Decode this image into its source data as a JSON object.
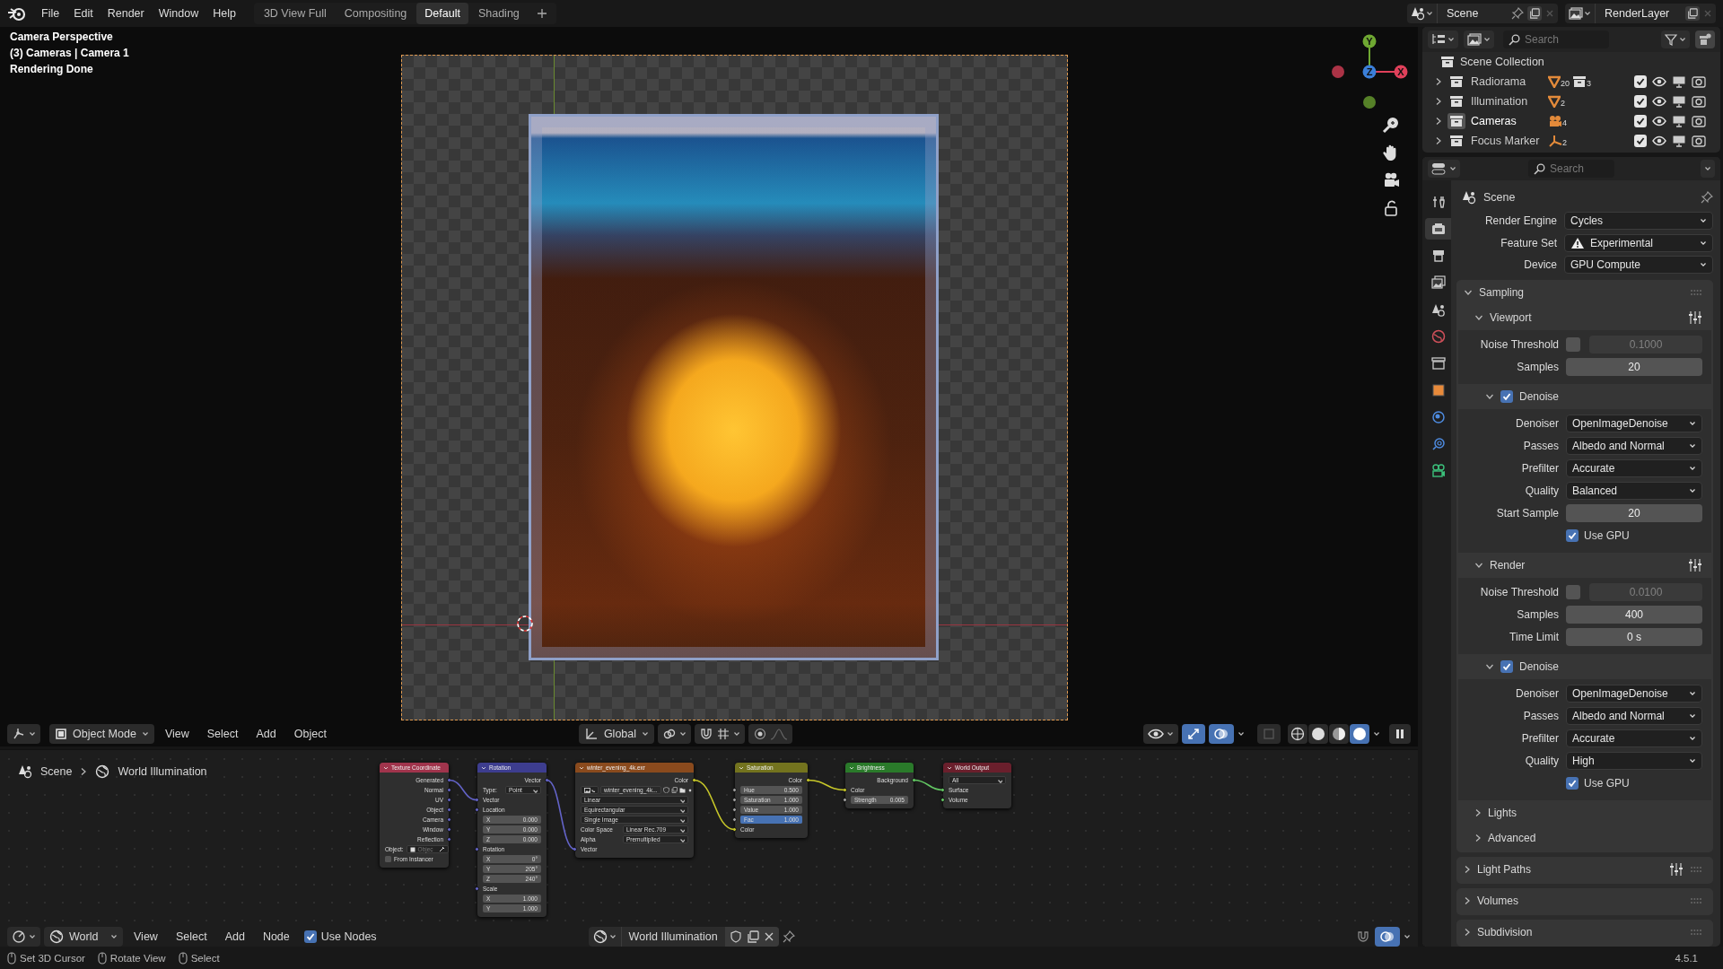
{
  "top_bar": {
    "menu": [
      "File",
      "Edit",
      "Render",
      "Window",
      "Help"
    ],
    "workspaces": [
      {
        "label": "3D View Full",
        "selected": false
      },
      {
        "label": "Compositing",
        "selected": false
      },
      {
        "label": "Default",
        "selected": true
      },
      {
        "label": "Shading",
        "selected": false
      }
    ],
    "scene": "Scene",
    "view_layer": "RenderLayer"
  },
  "viewport": {
    "info": [
      "Camera Perspective",
      "(3) Cameras | Camera 1",
      "Rendering Done"
    ],
    "gizmo": [
      {
        "axis": "Y",
        "color": "#6fa832"
      },
      {
        "axis": "Z",
        "color": "#3b7fd9"
      },
      {
        "axis": "X",
        "color": "#e0405a"
      }
    ],
    "header": {
      "mode": "Object Mode",
      "menus": [
        "View",
        "Select",
        "Add",
        "Object"
      ],
      "orientation": "Global",
      "shading": [
        {
          "kind": "wireframe",
          "selected": false
        },
        {
          "kind": "solid",
          "selected": false
        },
        {
          "kind": "material",
          "selected": false
        },
        {
          "kind": "rendered",
          "selected": true
        }
      ]
    }
  },
  "node_editor": {
    "breadcrumbs": [
      "Scene",
      "World Illumination"
    ],
    "nodes": [
      {
        "title": "Texture Coordinate",
        "color": "#a0344c",
        "rows": [
          {
            "kind": "output",
            "label": "Generated",
            "color": "#6363c7"
          },
          {
            "kind": "output",
            "label": "Normal",
            "color": "#6363c7"
          },
          {
            "kind": "output",
            "label": "UV",
            "color": "#6363c7"
          },
          {
            "kind": "output",
            "label": "Object",
            "color": "#6363c7"
          },
          {
            "kind": "output",
            "label": "Camera",
            "color": "#6363c7"
          },
          {
            "kind": "output",
            "label": "Window",
            "color": "#6363c7"
          },
          {
            "kind": "output",
            "label": "Reflection",
            "color": "#6363c7"
          },
          {
            "kind": "object_field",
            "label": "Object:",
            "placeholder": "Objec"
          },
          {
            "kind": "checkbox",
            "label": "From Instancer",
            "checked": false
          }
        ]
      },
      {
        "title": "Rotation",
        "color": "#3d3d8f",
        "rows": [
          {
            "kind": "output",
            "label": "Vector",
            "color": "#6363c7"
          },
          {
            "kind": "labeled_dropdown",
            "label": "Type:",
            "value": "Point"
          },
          {
            "kind": "input",
            "label": "Vector",
            "color": "#6363c7"
          },
          {
            "kind": "input",
            "label": "Location",
            "color": "#6363c7"
          },
          {
            "kind": "field",
            "label": "X",
            "value": "0.000"
          },
          {
            "kind": "field",
            "label": "Y",
            "value": "0.000"
          },
          {
            "kind": "field",
            "label": "Z",
            "value": "0.000"
          },
          {
            "kind": "input",
            "label": "Rotation",
            "color": "#6363c7"
          },
          {
            "kind": "field",
            "label": "X",
            "value": "0°"
          },
          {
            "kind": "field",
            "label": "Y",
            "value": "205°"
          },
          {
            "kind": "field",
            "label": "Z",
            "value": "240°"
          },
          {
            "kind": "input",
            "label": "Scale",
            "color": "#6363c7"
          },
          {
            "kind": "field",
            "label": "X",
            "value": "1.000"
          },
          {
            "kind": "field",
            "label": "Y",
            "value": "1.000"
          }
        ]
      },
      {
        "title": "winter_evening_4k.exr",
        "color": "#8a4a1d",
        "rows": [
          {
            "kind": "output",
            "label": "Color",
            "color": "#c7c729"
          },
          {
            "kind": "image_field",
            "value": "winter_evening_4k..."
          },
          {
            "kind": "dropdown",
            "value": "Linear"
          },
          {
            "kind": "dropdown",
            "value": "Equirectangular"
          },
          {
            "kind": "dropdown",
            "value": "Single Image"
          },
          {
            "kind": "labeled_dropdown",
            "label": "Color Space",
            "value": "Linear Rec.709"
          },
          {
            "kind": "labeled_dropdown",
            "label": "Alpha",
            "value": "Premultiplied"
          },
          {
            "kind": "input",
            "label": "Vector",
            "color": "#6363c7"
          }
        ]
      },
      {
        "title": "Saturation",
        "color": "#73731e",
        "rows": [
          {
            "kind": "output",
            "label": "Color",
            "color": "#c7c729"
          },
          {
            "kind": "input_field",
            "label": "Hue",
            "value": "0.500",
            "color": "#a1a1a1"
          },
          {
            "kind": "input_field",
            "label": "Saturation",
            "value": "1.000",
            "color": "#a1a1a1"
          },
          {
            "kind": "input_field",
            "label": "Value",
            "value": "1.000",
            "color": "#a1a1a1"
          },
          {
            "kind": "slider",
            "label": "Fac",
            "value": "1.000",
            "level": 1,
            "color": "#a1a1a1"
          },
          {
            "kind": "input",
            "label": "Color",
            "color": "#c7c729"
          }
        ]
      },
      {
        "title": "Brightness",
        "color": "#2a7a2a",
        "rows": [
          {
            "kind": "output",
            "label": "Background",
            "color": "#63c763"
          },
          {
            "kind": "input",
            "label": "Color",
            "color": "#c7c729"
          },
          {
            "kind": "input_field",
            "label": "Strength",
            "value": "0.005",
            "color": "#a1a1a1"
          }
        ]
      },
      {
        "title": "World Output",
        "color": "#6a1f2c",
        "rows": [
          {
            "kind": "dropdown",
            "value": "All"
          },
          {
            "kind": "input",
            "label": "Surface",
            "color": "#63c763"
          },
          {
            "kind": "input",
            "label": "Volume",
            "color": "#63c763"
          }
        ]
      }
    ],
    "header": {
      "data_type": "World",
      "menus": [
        "View",
        "Select",
        "Add",
        "Node"
      ],
      "use_nodes": {
        "label": "Use Nodes",
        "checked": true
      },
      "world": "World Illumination"
    }
  },
  "outliner": {
    "search_placeholder": "Search",
    "root": "Scene Collection",
    "collections": [
      {
        "name": "Radiorama",
        "selected": false,
        "checked": true,
        "contents": [
          {
            "kind": "light",
            "count": "20"
          },
          {
            "kind": "collection",
            "count": "3"
          }
        ]
      },
      {
        "name": "Illumination",
        "selected": false,
        "checked": true,
        "contents": [
          {
            "kind": "light",
            "count": "2"
          }
        ]
      },
      {
        "name": "Cameras",
        "selected": true,
        "checked": true,
        "contents": [
          {
            "kind": "camera",
            "count": "4"
          }
        ]
      },
      {
        "name": "Focus Marker",
        "selected": false,
        "checked": true,
        "contents": [
          {
            "kind": "empty",
            "count": "2"
          }
        ]
      }
    ]
  },
  "properties": {
    "search_placeholder": "Search",
    "tabs": [
      {
        "kind": "tool",
        "selected": false
      },
      {
        "kind": "render",
        "selected": true
      },
      {
        "kind": "output",
        "selected": false
      },
      {
        "kind": "view_layer",
        "selected": false
      },
      {
        "kind": "scene",
        "selected": false
      },
      {
        "kind": "world",
        "selected": false
      },
      {
        "kind": "collection",
        "selected": false
      },
      {
        "kind": "object",
        "selected": false
      },
      {
        "kind": "physics",
        "selected": false
      },
      {
        "kind": "constraints",
        "selected": false
      },
      {
        "kind": "camera_data",
        "selected": false
      }
    ],
    "context": "Scene",
    "rows": [
      {
        "kind": "dropdown",
        "label": "Render Engine",
        "value": "Cycles",
        "warning": false
      },
      {
        "kind": "dropdown",
        "label": "Feature Set",
        "value": "Experimental",
        "warning": true
      },
      {
        "kind": "dropdown",
        "label": "Device",
        "value": "GPU Compute",
        "warning": false
      }
    ],
    "panels": [
      {
        "title": "Sampling",
        "expanded": true,
        "presets": false,
        "children": [
          {
            "title": "Viewport",
            "expanded": true,
            "presets": true,
            "rows": [
              {
                "kind": "toggle_number",
                "label": "Noise Threshold",
                "checked": false,
                "value": "0.1000"
              },
              {
                "kind": "number",
                "label": "Samples",
                "value": "20"
              }
            ],
            "children": [
              {
                "title": "Denoise",
                "expanded": true,
                "presets": false,
                "checked": true,
                "rows": [
                  {
                    "kind": "dropdown",
                    "label": "Denoiser",
                    "value": "OpenImageDenoise"
                  },
                  {
                    "kind": "dropdown",
                    "label": "Passes",
                    "value": "Albedo and Normal"
                  },
                  {
                    "kind": "dropdown",
                    "label": "Prefilter",
                    "value": "Accurate"
                  },
                  {
                    "kind": "dropdown",
                    "label": "Quality",
                    "value": "Balanced"
                  },
                  {
                    "kind": "number",
                    "label": "Start Sample",
                    "value": "20"
                  },
                  {
                    "kind": "checkbox",
                    "label": "Use GPU",
                    "checked": true
                  }
                ]
              }
            ]
          },
          {
            "title": "Render",
            "expanded": true,
            "presets": true,
            "rows": [
              {
                "kind": "toggle_number",
                "label": "Noise Threshold",
                "checked": false,
                "value": "0.0100"
              },
              {
                "kind": "number",
                "label": "Samples",
                "value": "400"
              },
              {
                "kind": "number",
                "label": "Time Limit",
                "value": "0 s"
              }
            ],
            "children": [
              {
                "title": "Denoise",
                "expanded": true,
                "presets": false,
                "checked": true,
                "rows": [
                  {
                    "kind": "dropdown",
                    "label": "Denoiser",
                    "value": "OpenImageDenoise"
                  },
                  {
                    "kind": "dropdown",
                    "label": "Passes",
                    "value": "Albedo and Normal"
                  },
                  {
                    "kind": "dropdown",
                    "label": "Prefilter",
                    "value": "Accurate"
                  },
                  {
                    "kind": "dropdown",
                    "label": "Quality",
                    "value": "High"
                  },
                  {
                    "kind": "checkbox",
                    "label": "Use GPU",
                    "checked": true
                  }
                ]
              }
            ]
          },
          {
            "title": "Lights",
            "expanded": false,
            "presets": false
          },
          {
            "title": "Advanced",
            "expanded": false,
            "presets": false
          }
        ]
      },
      {
        "title": "Light Paths",
        "expanded": false,
        "presets": true
      },
      {
        "title": "Volumes",
        "expanded": false,
        "presets": false
      },
      {
        "title": "Subdivision",
        "expanded": false,
        "presets": false
      }
    ]
  },
  "status_bar": {
    "hints": [
      "Set 3D Cursor",
      "Rotate View",
      "Select"
    ],
    "version": "4.5.1"
  }
}
